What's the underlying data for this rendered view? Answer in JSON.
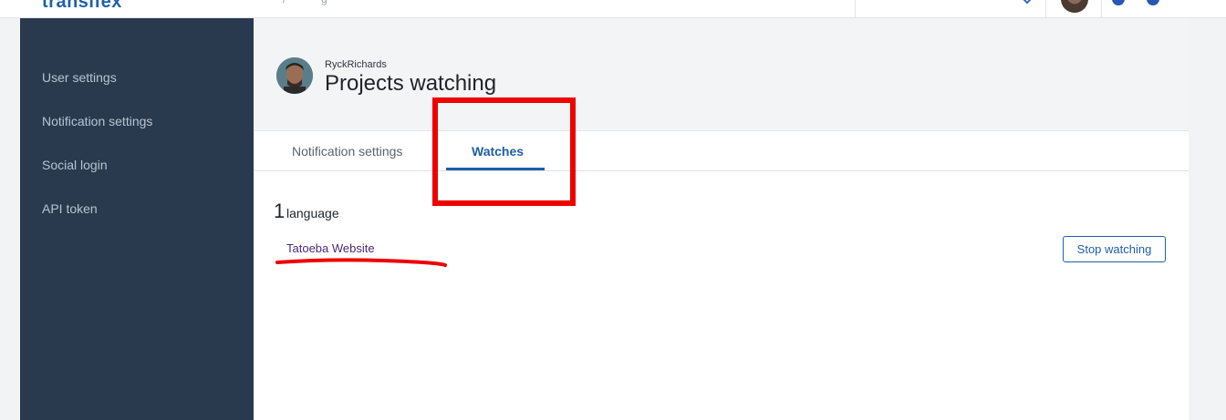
{
  "topbar": {
    "logo": "transifex",
    "crumb_a": "/",
    "crumb_b": "g"
  },
  "sidebar": {
    "items": [
      {
        "label": "User settings"
      },
      {
        "label": "Notification settings"
      },
      {
        "label": "Social login"
      },
      {
        "label": "API token"
      }
    ]
  },
  "header": {
    "username": "RyckRichards",
    "title": "Projects watching"
  },
  "tabs": [
    {
      "label": "Notification settings",
      "active": false
    },
    {
      "label": "Watches",
      "active": true
    }
  ],
  "watches": {
    "count": "1",
    "count_label": "language",
    "items": [
      {
        "project": "Tatoeba Website",
        "action": "Stop watching"
      }
    ]
  },
  "colors": {
    "sidebar_bg": "#293a4f",
    "accent": "#1f5ea8",
    "annotation": "#ee0000"
  }
}
